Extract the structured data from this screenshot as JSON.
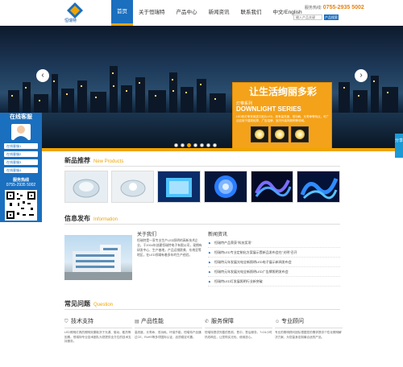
{
  "header": {
    "logo_text": "恒瑞特",
    "nav": [
      {
        "label": "首页",
        "active": true
      },
      {
        "label": "关于恒瑞特"
      },
      {
        "label": "产品中心"
      },
      {
        "label": "新闻资讯"
      },
      {
        "label": "联系我们"
      },
      {
        "label": "中文/English"
      }
    ],
    "hotline_label": "服务热线:",
    "hotline": "0755-2935 5002",
    "search_placeholder": "输入产品关键",
    "search_button": "产品搜索"
  },
  "banner": {
    "headline": "让生活绚丽多彩",
    "series_cn": "灯带系列",
    "series_en": "DOWNLIGHT SERIES",
    "description": "LED软灯条采用进口贴片LED，具有高亮度、低功耗、长寿命等特点，可广泛应用于建筑轮廓、广告招牌、室内外装饰照明等领域。",
    "prev_icon": "chevron-left-icon",
    "next_icon": "chevron-right-icon",
    "slides": 7,
    "active_slide": 3
  },
  "service": {
    "title": "在线客服",
    "buttons": [
      "在线客服1",
      "在线客服2",
      "在线客服3",
      "在线客服4"
    ],
    "phone_label": "服务热线",
    "phone": "0755-2935 5002"
  },
  "right_tab": "分享",
  "products": {
    "title": "新品推荐",
    "title_en": "New Products",
    "items": [
      "LED透镜",
      "LED透镜",
      "LED方块灯",
      "LED球灯",
      "LED灯带",
      "LED灯带"
    ]
  },
  "info": {
    "title": "信息发布",
    "title_en": "Information",
    "about_title": "关于我们",
    "about_text": "恒瑞特是一家专业生产LED照明的高新技术企业，于2004年创建恒瑞特电子有限公司，现拥有研发中心、生产基地，产品远销欧美、东南亚等地区，在LED领域有着多年的生产经验。",
    "news_title": "新闻资讯",
    "news": [
      "恒瑞特产品荣获\"科技奖项\"",
      "恒瑞特LED专业定制化方案展示暨新品发布会在\"光明\"召开",
      "恒瑞特元年发展光电全新照明LED电子展示新闻发布会",
      "恒瑞特元年发展光电全新照明LED广告牌照明发布会",
      "恒瑞特LED灯发展照明行业新突破"
    ]
  },
  "faq": {
    "title": "常见问题",
    "title_en": "Question",
    "items": [
      {
        "icon": "shield-icon",
        "title": "技术支持",
        "text": "LED照明灯具的照明效果取决于光源、驱动、散热等因素，恒瑞特专业技术团队为您提供全方位的技术支持服务。"
      },
      {
        "icon": "doc-icon",
        "title": "产品性能",
        "text": "高亮度、长寿命、低功耗、环保节能，恒瑞特产品通过CE、RoHS等多项国际认证，品质稳定可靠。"
      },
      {
        "icon": "phone-icon",
        "title": "服务保障",
        "text": "恒瑞特提供完善的售前、售中、售后服务，7×24小时热线响应，让您购买无忧、使用放心。"
      },
      {
        "icon": "person-icon",
        "title": "专业顾问",
        "text": "专业的照明顾问团队根据您的需求提供个性化照明解决方案，为您量身定制最合适的产品。"
      }
    ]
  },
  "colors": {
    "brand_blue": "#1b6fbf",
    "accent_orange": "#f0a400"
  }
}
